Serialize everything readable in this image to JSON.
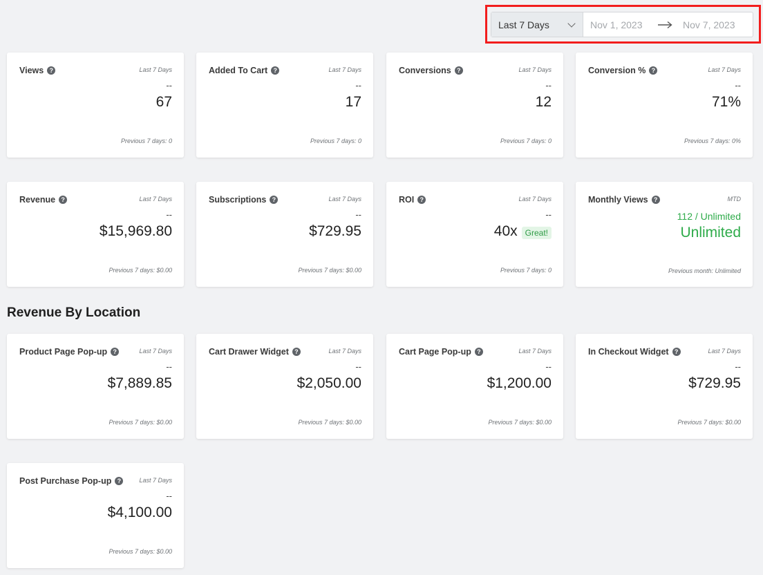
{
  "date_filter": {
    "range_label": "Last 7 Days",
    "start_placeholder": "Nov 1, 2023",
    "end_placeholder": "Nov 7, 2023"
  },
  "cards_row1": [
    {
      "title": "Views",
      "period": "Last 7 Days",
      "dash": "--",
      "value": "67",
      "previous": "Previous 7 days: 0"
    },
    {
      "title": "Added To Cart",
      "period": "Last 7 Days",
      "dash": "--",
      "value": "17",
      "previous": "Previous 7 days: 0"
    },
    {
      "title": "Conversions",
      "period": "Last 7 Days",
      "dash": "--",
      "value": "12",
      "previous": "Previous 7 days: 0"
    },
    {
      "title": "Conversion %",
      "period": "Last 7 Days",
      "dash": "--",
      "value": "71%",
      "previous": "Previous 7 days: 0%"
    }
  ],
  "cards_row2": [
    {
      "title": "Revenue",
      "period": "Last 7 Days",
      "dash": "--",
      "value": "$15,969.80",
      "previous": "Previous 7 days: $0.00"
    },
    {
      "title": "Subscriptions",
      "period": "Last 7 Days",
      "dash": "--",
      "value": "$729.95",
      "previous": "Previous 7 days: $0.00"
    },
    {
      "title": "ROI",
      "period": "Last 7 Days",
      "dash": "--",
      "value": "40x",
      "badge": "Great!",
      "previous": "Previous 7 days: 0"
    },
    {
      "title": "Monthly Views",
      "period": "MTD",
      "usage": "112 / Unlimited",
      "value": "Unlimited",
      "previous": "Previous month: Unlimited"
    }
  ],
  "section_title": "Revenue By Location",
  "location_cards": [
    {
      "title": "Product Page Pop-up",
      "period": "Last 7 Days",
      "dash": "--",
      "value": "$7,889.85",
      "previous": "Previous 7 days: $0.00"
    },
    {
      "title": "Cart Drawer Widget",
      "period": "Last 7 Days",
      "dash": "--",
      "value": "$2,050.00",
      "previous": "Previous 7 days: $0.00"
    },
    {
      "title": "Cart Page Pop-up",
      "period": "Last 7 Days",
      "dash": "--",
      "value": "$1,200.00",
      "previous": "Previous 7 days: $0.00"
    },
    {
      "title": "In Checkout Widget",
      "period": "Last 7 Days",
      "dash": "--",
      "value": "$729.95",
      "previous": "Previous 7 days: $0.00"
    },
    {
      "title": "Post Purchase Pop-up",
      "period": "Last 7 Days",
      "dash": "--",
      "value": "$4,100.00",
      "previous": "Previous 7 days: $0.00"
    }
  ],
  "help_glyph": "?",
  "colors": {
    "background": "#f1f2f4",
    "highlight": "#f21d1d",
    "success": "#2eab4a",
    "badge_bg": "#e3f5e6"
  }
}
